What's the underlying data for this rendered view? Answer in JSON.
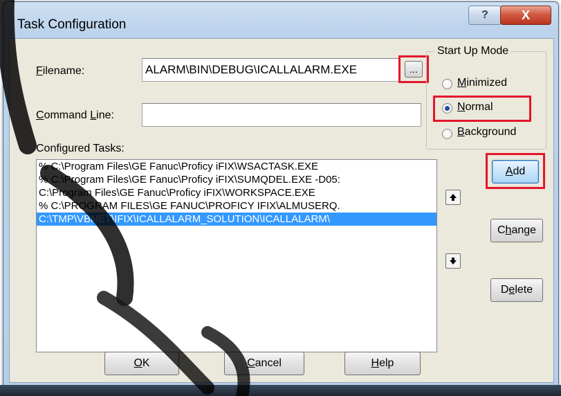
{
  "window": {
    "title": "Task Configuration",
    "help_glyph": "?",
    "close_glyph": "X"
  },
  "filename": {
    "label_pre": "",
    "label_underline": "F",
    "label_post": "ilename:",
    "value": "ALARM\\BIN\\DEBUG\\ICALLALARM.EXE",
    "browse_label": "..."
  },
  "command_line": {
    "label_underline": "C",
    "label_post": "ommand ",
    "label_underline2": "L",
    "label_post2": "ine:",
    "value": ""
  },
  "configured_tasks": {
    "label": "Configured Tasks:",
    "rows": [
      "% C:\\Program Files\\GE Fanuc\\Proficy iFIX\\WSACTASK.EXE",
      "% C:\\Program Files\\GE Fanuc\\Proficy iFIX\\SUMQDEL.EXE  -D05:",
      " C:\\Program Files\\GE Fanuc\\Proficy iFIX\\WORKSPACE.EXE",
      "% C:\\PROGRAM FILES\\GE FANUC\\PROFICY IFIX\\ALMUSERQ.",
      " C:\\TMP\\VBNET\\IFIX\\ICALLALARM_SOLUTION\\ICALLALARM\\"
    ],
    "selected_index": 4
  },
  "startup_mode": {
    "title": "Start Up Mode",
    "options": [
      {
        "pre": "",
        "u": "M",
        "post": "inimized",
        "selected": false
      },
      {
        "pre": "",
        "u": "N",
        "post": "ormal",
        "selected": true
      },
      {
        "pre": "",
        "u": "B",
        "post": "ackground",
        "selected": false
      }
    ]
  },
  "buttons": {
    "add": {
      "u": "A",
      "post": "dd"
    },
    "change": {
      "pre": "C",
      "u": "h",
      "post": "ange"
    },
    "delete": {
      "pre": "D",
      "u": "e",
      "post": "lete"
    },
    "ok": {
      "u": "O",
      "post": "K"
    },
    "cancel": {
      "u": "C",
      "post": "ancel"
    },
    "help": {
      "u": "H",
      "post": "elp"
    }
  },
  "colors": {
    "highlight": "#e3162b",
    "selection": "#3399ff"
  }
}
